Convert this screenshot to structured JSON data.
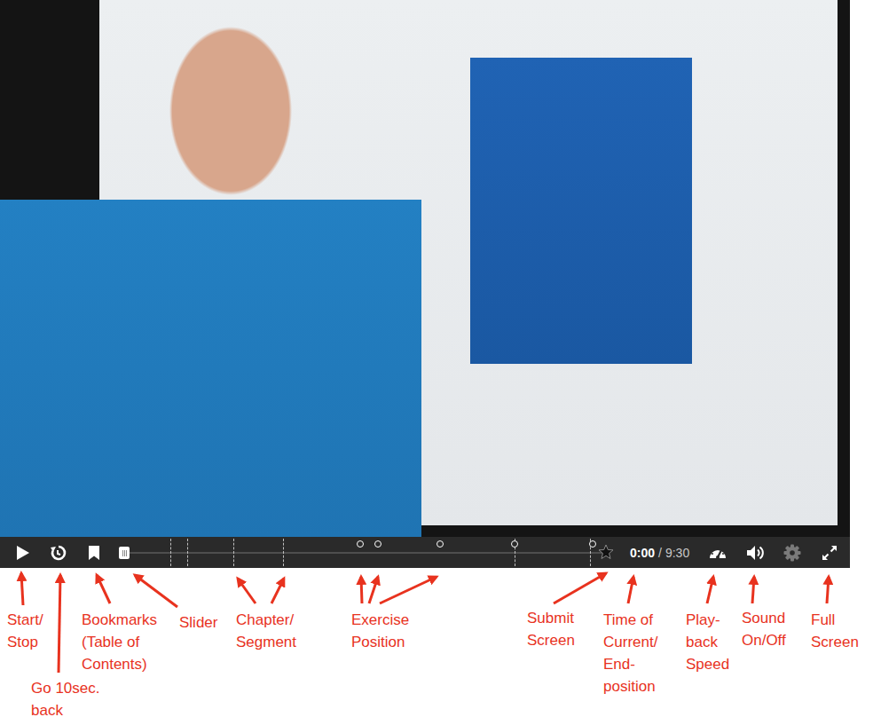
{
  "player": {
    "time_current": "0:00",
    "time_separator": "/",
    "time_end": "9:30",
    "level": 0,
    "settings_disabled": true
  },
  "markers": [
    {
      "kind": "chapter",
      "level": 0.096
    },
    {
      "kind": "chapter",
      "level": 0.131
    },
    {
      "kind": "chapter",
      "level": 0.227
    },
    {
      "kind": "chapter",
      "level": 0.33
    },
    {
      "kind": "chapter",
      "level": 0.812
    },
    {
      "kind": "chapter",
      "level": 0.969
    },
    {
      "kind": "exercise",
      "level": 0.491
    },
    {
      "kind": "exercise",
      "level": 0.528
    },
    {
      "kind": "exercise",
      "level": 0.657
    },
    {
      "kind": "exercise",
      "level": 0.812
    },
    {
      "kind": "exercise",
      "level": 0.974
    }
  ],
  "annotations": [
    {
      "lines": [
        "Start/",
        "Stop"
      ]
    },
    {
      "lines": [
        "Go 10sec.",
        "back"
      ]
    },
    {
      "lines": [
        "Bookmarks",
        "(Table of",
        "Contents)"
      ]
    },
    {
      "lines": [
        "Slider"
      ]
    },
    {
      "lines": [
        "Chapter/",
        "Segment"
      ]
    },
    {
      "lines": [
        "Exercise",
        "Position"
      ]
    },
    {
      "lines": [
        "Submit",
        "Screen"
      ]
    },
    {
      "lines": [
        "Time of",
        "Current/",
        "End-",
        "position"
      ]
    },
    {
      "lines": [
        "Play-",
        "back",
        "Speed"
      ]
    },
    {
      "lines": [
        "Sound",
        "On/Off"
      ]
    },
    {
      "lines": [
        "Full",
        "Screen"
      ]
    }
  ]
}
